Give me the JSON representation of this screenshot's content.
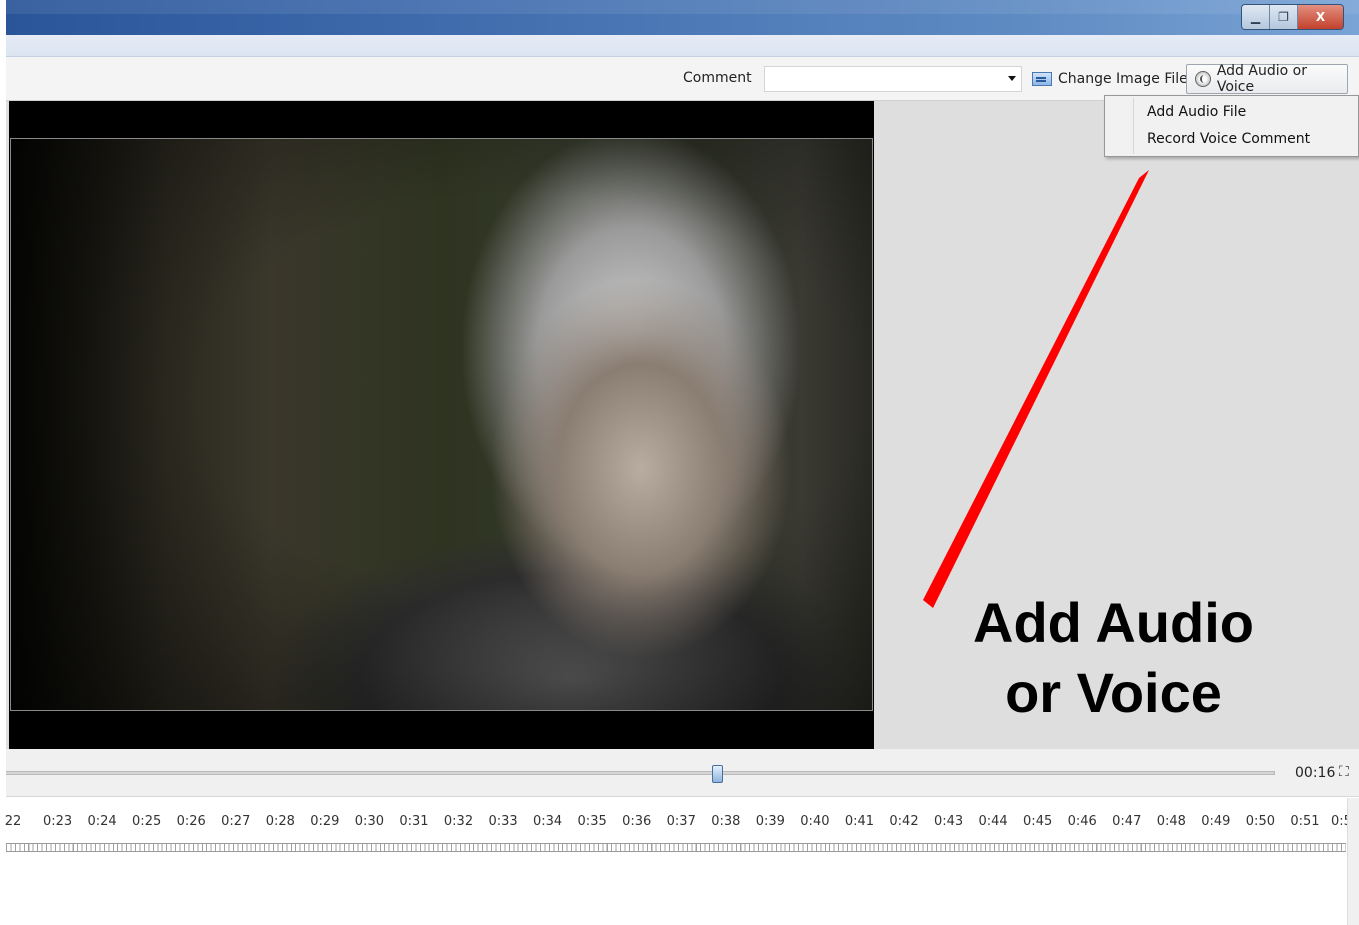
{
  "window": {
    "controls": {
      "minimize_glyph": "▁",
      "maximize_glyph": "❐",
      "close_glyph": "X"
    }
  },
  "toolbar": {
    "comment_label": "Comment",
    "comment_value": "",
    "change_image_label": "Change Image File",
    "add_audio_label": "Add Audio or Voice",
    "change_image_icon": "image-file-icon",
    "add_audio_icon": "speaker-icon"
  },
  "dropdown": {
    "items": [
      {
        "label": "Add Audio File"
      },
      {
        "label": "Record Voice Comment"
      }
    ]
  },
  "annotation": {
    "line1": "Add Audio",
    "line2": "or Voice",
    "color": "#ff0000"
  },
  "playback": {
    "time": "00:16",
    "fullscreen_glyph": "⛶"
  },
  "timeline": {
    "ticks": [
      "22",
      "0:23",
      "0:24",
      "0:25",
      "0:26",
      "0:27",
      "0:28",
      "0:29",
      "0:30",
      "0:31",
      "0:32",
      "0:33",
      "0:34",
      "0:35",
      "0:36",
      "0:37",
      "0:38",
      "0:39",
      "0:40",
      "0:41",
      "0:42",
      "0:43",
      "0:44",
      "0:45",
      "0:46",
      "0:47",
      "0:48",
      "0:49",
      "0:50",
      "0:51",
      "0:5"
    ]
  }
}
